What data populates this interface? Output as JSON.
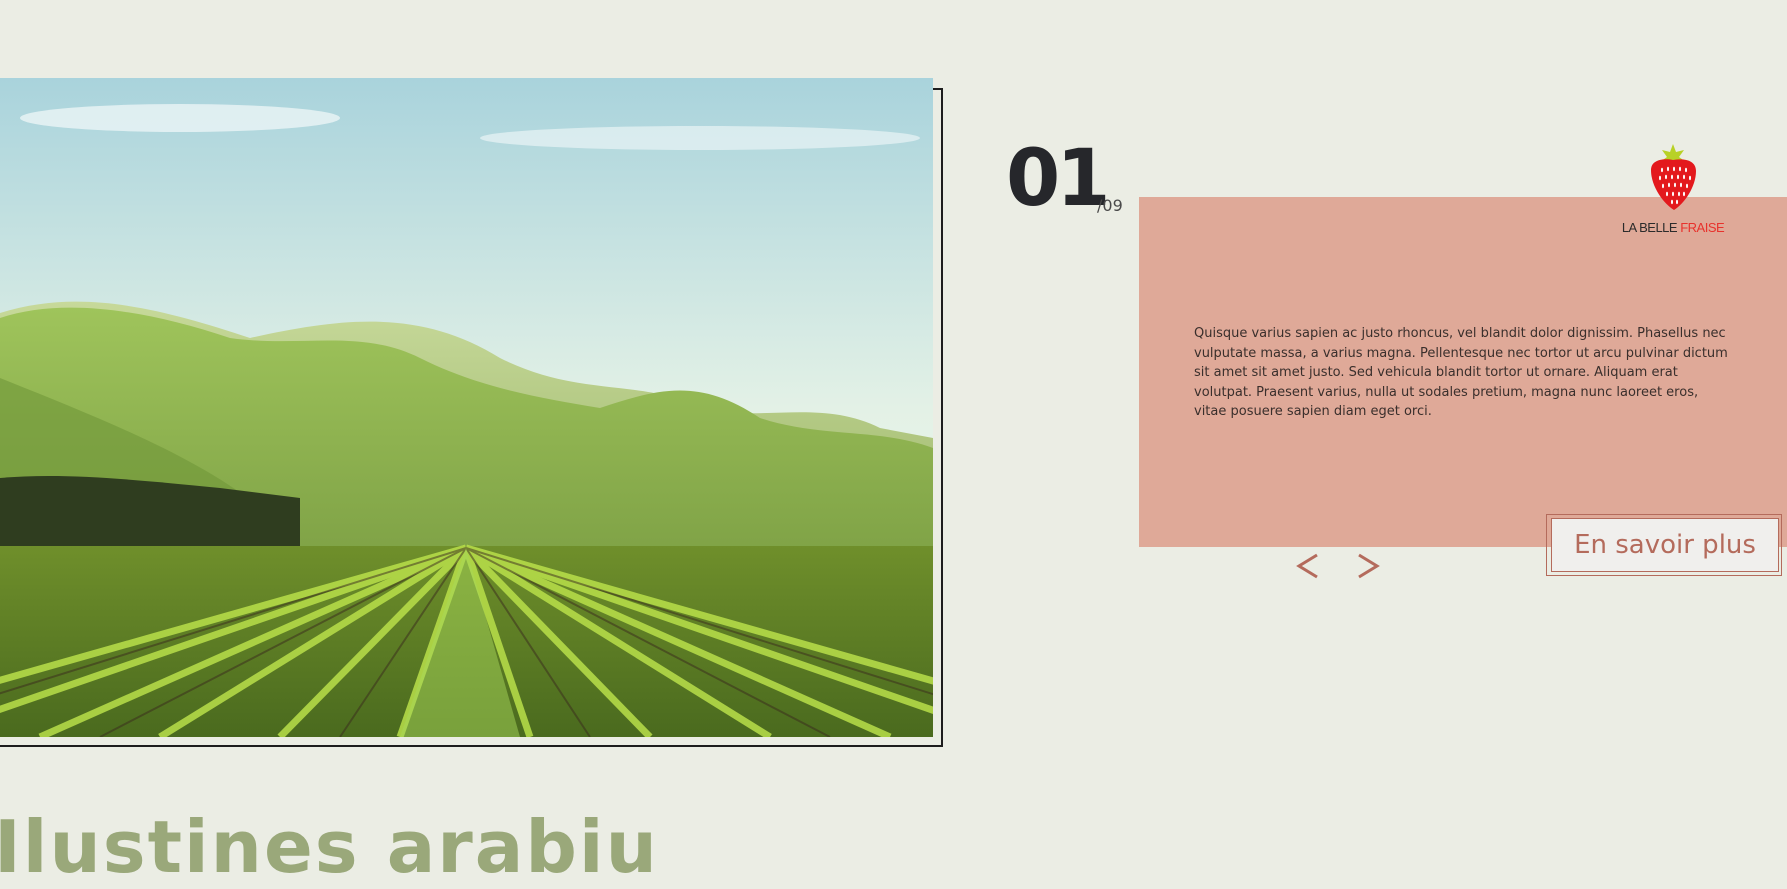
{
  "slider": {
    "current": "01",
    "total": "/09"
  },
  "card": {
    "body_text": "Quisque varius sapien ac justo rhoncus, vel blandit dolor dignissim. Phasellus nec vulputate massa, a varius magna. Pellentesque nec tortor ut arcu pulvinar dictum sit amet sit amet justo. Sed vehicula blandit tortor ut ornare. Aliquam erat volutpat. Praesent varius, nulla ut sodales pretium, magna nunc laoreet eros, vitae posuere sapien diam eget orci.",
    "cta_label": "En savoir plus"
  },
  "logo": {
    "text_part1": "LA BELLE ",
    "text_part2": "FRAISE",
    "icon": "strawberry-icon"
  },
  "nav": {
    "prev_icon": "chevron-left-icon",
    "next_icon": "chevron-right-icon"
  },
  "colors": {
    "background": "#ebede4",
    "card": "#dfa998",
    "accent": "#b46b5c",
    "logo_red": "#e8322c",
    "heading_green": "#9aa87a"
  },
  "bottom": {
    "heading": "Ilustines arabiu"
  }
}
